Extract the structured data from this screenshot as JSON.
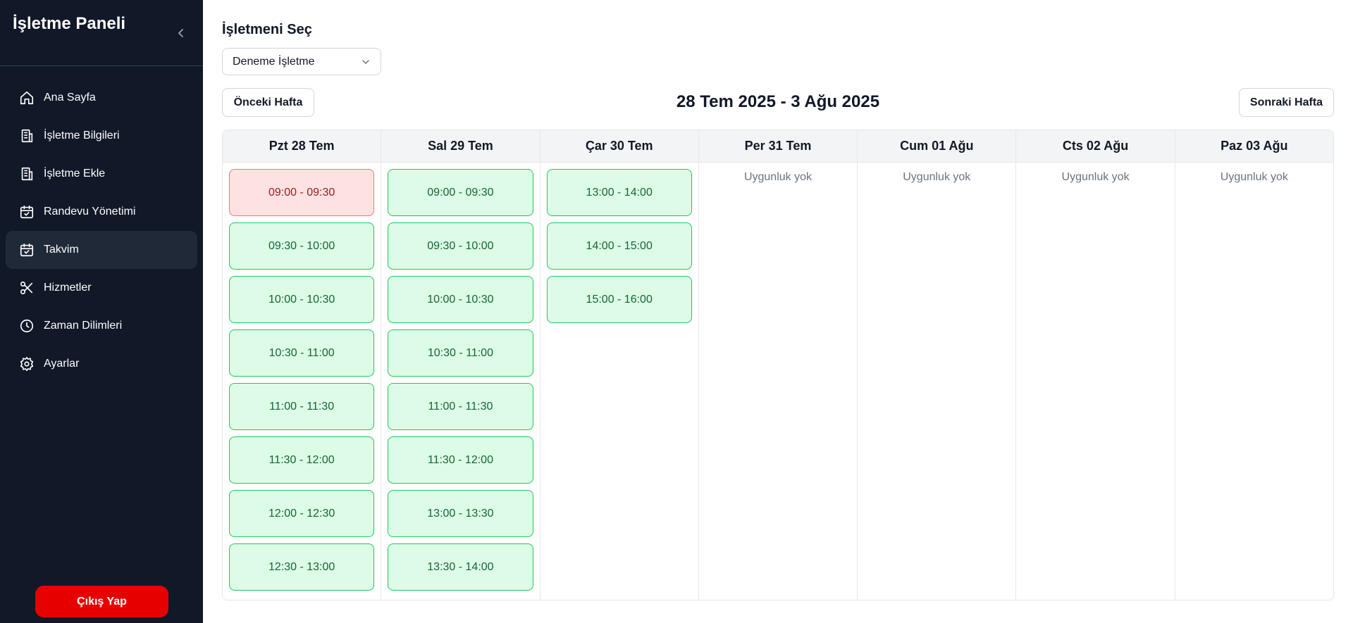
{
  "sidebar": {
    "brand": "İşletme Paneli",
    "items": [
      {
        "label": "Ana Sayfa",
        "icon": "home-icon"
      },
      {
        "label": "İşletme Bilgileri",
        "icon": "building-icon"
      },
      {
        "label": "İşletme Ekle",
        "icon": "building-add-icon"
      },
      {
        "label": "Randevu Yönetimi",
        "icon": "calendar-check-icon"
      },
      {
        "label": "Takvim",
        "icon": "calendar-icon",
        "active": true
      },
      {
        "label": "Hizmetler",
        "icon": "scissors-icon"
      },
      {
        "label": "Zaman Dilimleri",
        "icon": "clock-icon"
      },
      {
        "label": "Ayarlar",
        "icon": "gear-icon"
      }
    ],
    "logout_label": "Çıkış Yap"
  },
  "main": {
    "section_title": "İşletmeni Seç",
    "business_select": {
      "value": "Deneme İşletme"
    },
    "prev_week_label": "Önceki Hafta",
    "next_week_label": "Sonraki Hafta",
    "week_range": "28 Tem 2025 - 3 Ağu 2025"
  },
  "calendar": {
    "empty_text": "Uygunluk yok",
    "days": [
      {
        "label": "Pzt 28 Tem",
        "slots": [
          {
            "time": "09:00 - 09:30",
            "status": "booked"
          },
          {
            "time": "09:30 - 10:00",
            "status": "free"
          },
          {
            "time": "10:00 - 10:30",
            "status": "free"
          },
          {
            "time": "10:30 - 11:00",
            "status": "free"
          },
          {
            "time": "11:00 - 11:30",
            "status": "free"
          },
          {
            "time": "11:30 - 12:00",
            "status": "free"
          },
          {
            "time": "12:00 - 12:30",
            "status": "free"
          },
          {
            "time": "12:30 - 13:00",
            "status": "free"
          }
        ]
      },
      {
        "label": "Sal 29 Tem",
        "slots": [
          {
            "time": "09:00 - 09:30",
            "status": "free"
          },
          {
            "time": "09:30 - 10:00",
            "status": "free"
          },
          {
            "time": "10:00 - 10:30",
            "status": "free"
          },
          {
            "time": "10:30 - 11:00",
            "status": "free"
          },
          {
            "time": "11:00 - 11:30",
            "status": "free"
          },
          {
            "time": "11:30 - 12:00",
            "status": "free"
          },
          {
            "time": "13:00 - 13:30",
            "status": "free"
          },
          {
            "time": "13:30 - 14:00",
            "status": "free"
          }
        ]
      },
      {
        "label": "Çar 30 Tem",
        "slots": [
          {
            "time": "13:00 - 14:00",
            "status": "free"
          },
          {
            "time": "14:00 - 15:00",
            "status": "free"
          },
          {
            "time": "15:00 - 16:00",
            "status": "free"
          }
        ]
      },
      {
        "label": "Per 31 Tem",
        "slots": []
      },
      {
        "label": "Cum 01 Ağu",
        "slots": []
      },
      {
        "label": "Cts 02 Ağu",
        "slots": []
      },
      {
        "label": "Paz 03 Ağu",
        "slots": []
      }
    ]
  },
  "colors": {
    "sidebar_bg": "#111827",
    "active_item_bg": "#1f2937",
    "logout_red": "#e60000",
    "slot_free_bg": "#dcfce7",
    "slot_free_border": "#22c55e",
    "slot_booked_bg": "#fee2e2",
    "slot_booked_border": "#f87171"
  }
}
